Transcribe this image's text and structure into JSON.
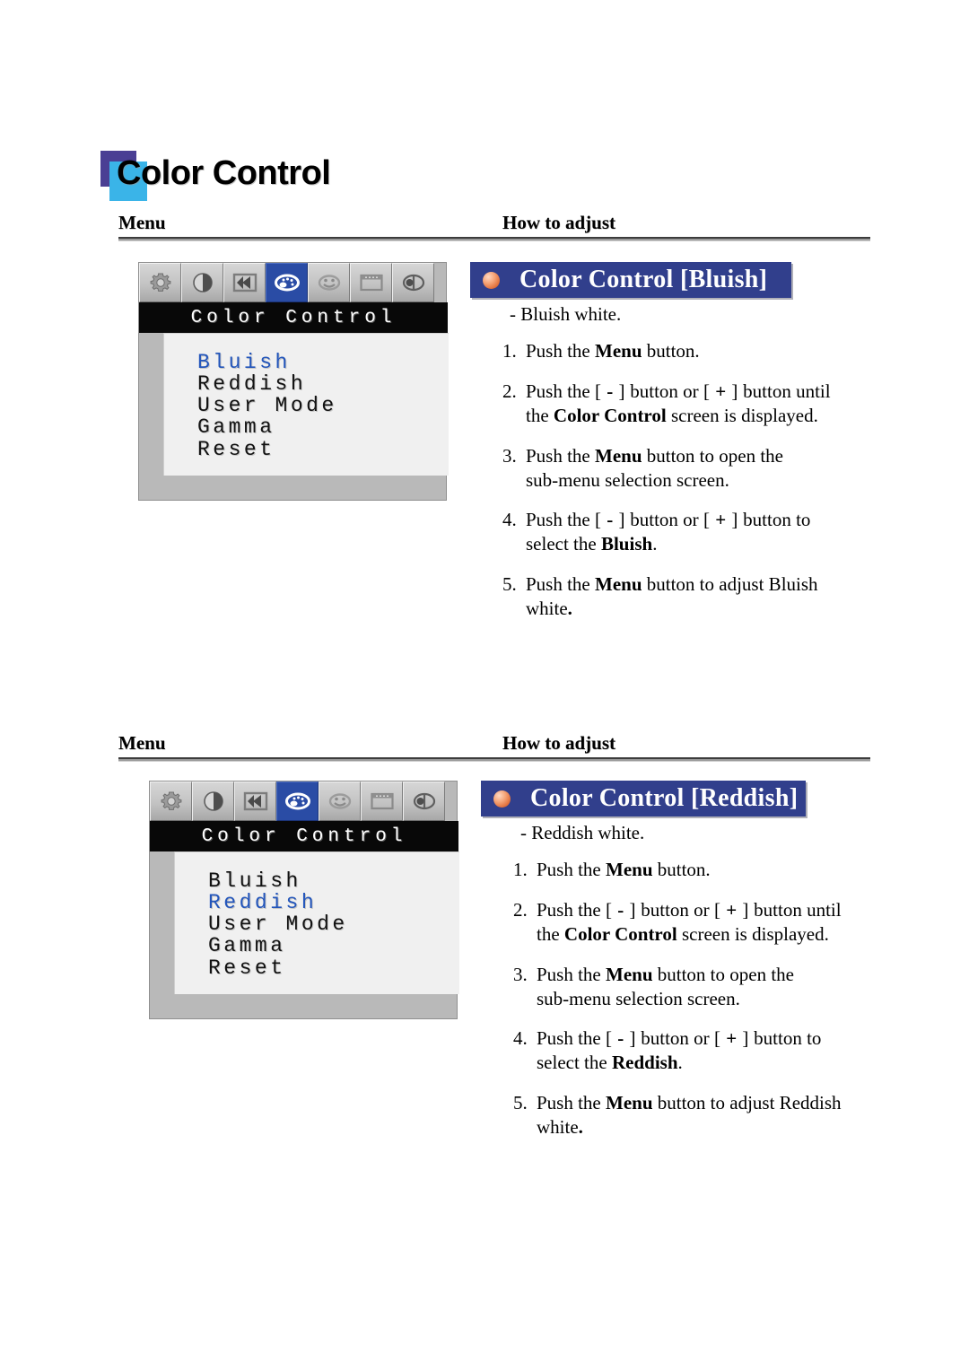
{
  "page": {
    "title": "Color Control",
    "accent_square_back": "#4a3f94",
    "accent_square_front": "#3ab4e8",
    "header_bar_color": "#313f8c",
    "osd_highlight_color": "#2255bb",
    "osd_selected_icon_color": "#2a4ca5"
  },
  "columns": {
    "menu_header": "Menu",
    "adjust_header": "How to adjust"
  },
  "osd": {
    "title": "Color Control",
    "icons": [
      "gear-icon",
      "contrast-icon",
      "position-icon",
      "palette-icon",
      "osd-face-icon",
      "screen-icon",
      "sharpness-icon"
    ],
    "items": [
      "Bluish",
      "Reddish",
      "User Mode",
      "Gamma",
      "Reset"
    ]
  },
  "sections": [
    {
      "bar_title": "Color Control [Bluish]",
      "subnote": "-  Bluish white.",
      "highlighted_item": "Bluish",
      "steps": [
        {
          "num": "1.",
          "lines": [
            [
              {
                "t": "Push the ",
                "b": false
              },
              {
                "t": "Menu",
                "b": true
              },
              {
                "t": " button.",
                "b": false
              }
            ]
          ]
        },
        {
          "num": "2.",
          "lines": [
            [
              {
                "t": "Push the ",
                "b": false
              },
              {
                "t": "[ - ]",
                "b": false,
                "key": true
              },
              {
                "t": " button or ",
                "b": false
              },
              {
                "t": "[ + ]",
                "b": false,
                "key": true
              },
              {
                "t": " button until",
                "b": false
              }
            ],
            [
              {
                "t": "the ",
                "b": false
              },
              {
                "t": "Color Control",
                "b": true
              },
              {
                "t": " screen is displayed.",
                "b": false
              }
            ]
          ]
        },
        {
          "num": "3.",
          "lines": [
            [
              {
                "t": "Push the ",
                "b": false
              },
              {
                "t": "Menu",
                "b": true
              },
              {
                "t": " button to open the",
                "b": false
              }
            ],
            [
              {
                "t": "sub-menu selection screen.",
                "b": false
              }
            ]
          ]
        },
        {
          "num": "4.",
          "lines": [
            [
              {
                "t": "Push the ",
                "b": false
              },
              {
                "t": "[ - ]",
                "b": false,
                "key": true
              },
              {
                "t": " button or ",
                "b": false
              },
              {
                "t": "[ + ]",
                "b": false,
                "key": true
              },
              {
                "t": " button to",
                "b": false
              }
            ],
            [
              {
                "t": "select the ",
                "b": false
              },
              {
                "t": "Bluish",
                "b": true
              },
              {
                "t": ".",
                "b": false
              }
            ]
          ]
        },
        {
          "num": "5.",
          "lines": [
            [
              {
                "t": "Push the ",
                "b": false
              },
              {
                "t": "Menu",
                "b": true
              },
              {
                "t": " button to adjust Bluish",
                "b": false
              }
            ],
            [
              {
                "t": "white",
                "b": false
              },
              {
                "t": ".",
                "b": true
              }
            ]
          ]
        }
      ]
    },
    {
      "bar_title": "Color Control [Reddish]",
      "subnote": "-  Reddish white.",
      "highlighted_item": "Reddish",
      "steps": [
        {
          "num": "1.",
          "lines": [
            [
              {
                "t": "Push the ",
                "b": false
              },
              {
                "t": "Menu",
                "b": true
              },
              {
                "t": " button.",
                "b": false
              }
            ]
          ]
        },
        {
          "num": "2.",
          "lines": [
            [
              {
                "t": "Push the ",
                "b": false
              },
              {
                "t": "[ - ]",
                "b": false,
                "key": true
              },
              {
                "t": " button or ",
                "b": false
              },
              {
                "t": "[ + ]",
                "b": false,
                "key": true
              },
              {
                "t": " button until",
                "b": false
              }
            ],
            [
              {
                "t": "the ",
                "b": false
              },
              {
                "t": "Color Control",
                "b": true
              },
              {
                "t": " screen is displayed.",
                "b": false
              }
            ]
          ]
        },
        {
          "num": "3.",
          "lines": [
            [
              {
                "t": "Push the ",
                "b": false
              },
              {
                "t": "Menu",
                "b": true
              },
              {
                "t": " button to open the",
                "b": false
              }
            ],
            [
              {
                "t": "sub-menu selection screen.",
                "b": false
              }
            ]
          ]
        },
        {
          "num": "4.",
          "lines": [
            [
              {
                "t": "Push the ",
                "b": false
              },
              {
                "t": "[ - ]",
                "b": false,
                "key": true
              },
              {
                "t": " button or ",
                "b": false
              },
              {
                "t": "[ + ]",
                "b": false,
                "key": true
              },
              {
                "t": " button to",
                "b": false
              }
            ],
            [
              {
                "t": "select the ",
                "b": false
              },
              {
                "t": "Reddish",
                "b": true
              },
              {
                "t": ".",
                "b": false
              }
            ]
          ]
        },
        {
          "num": "5.",
          "lines": [
            [
              {
                "t": "Push the ",
                "b": false
              },
              {
                "t": "Menu",
                "b": true
              },
              {
                "t": " button to adjust Reddish",
                "b": false
              }
            ],
            [
              {
                "t": "white",
                "b": false
              },
              {
                "t": ".",
                "b": true
              }
            ]
          ]
        }
      ]
    }
  ]
}
